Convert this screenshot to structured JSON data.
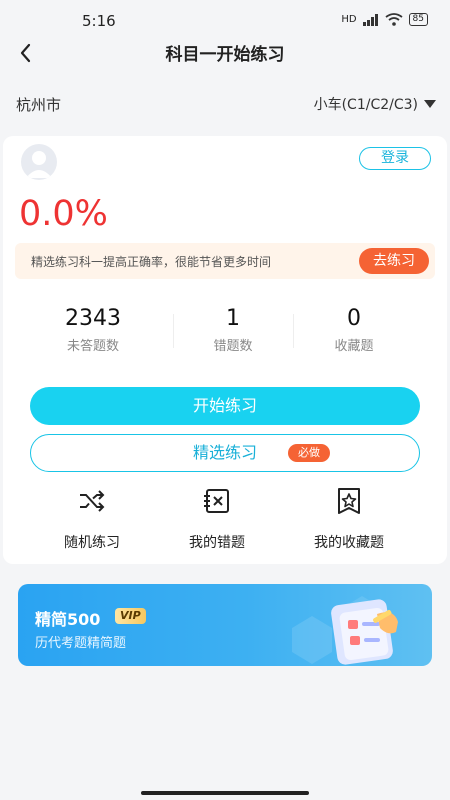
{
  "status_bar": {
    "time": "5:16",
    "battery": "85",
    "network": "HD"
  },
  "header": {
    "title": "科目一开始练习"
  },
  "location": {
    "city": "杭州市",
    "vehicle": "小车(C1/C2/C3)"
  },
  "profile": {
    "login_label": "登录",
    "accuracy": "0.0%"
  },
  "tip": {
    "text": "精选练习科一提高正确率，很能节省更多时间",
    "button": "去练习"
  },
  "stats": [
    {
      "value": "2343",
      "label": "未答题数"
    },
    {
      "value": "1",
      "label": "错题数"
    },
    {
      "value": "0",
      "label": "收藏题"
    }
  ],
  "actions": {
    "start_label": "开始练习",
    "select_label": "精选练习",
    "select_badge": "必做"
  },
  "quick_links": [
    {
      "label": "随机练习",
      "icon": "shuffle-icon"
    },
    {
      "label": "我的错题",
      "icon": "wrong-question-icon"
    },
    {
      "label": "我的收藏题",
      "icon": "favorite-star-icon"
    }
  ],
  "banner": {
    "title": "精简500",
    "tag": "VIP",
    "subtitle": "历代考题精简题"
  },
  "colors": {
    "accent": "#19d2f0",
    "danger": "#e33333",
    "orange": "#f56334",
    "banner": "#2aa3f2"
  }
}
